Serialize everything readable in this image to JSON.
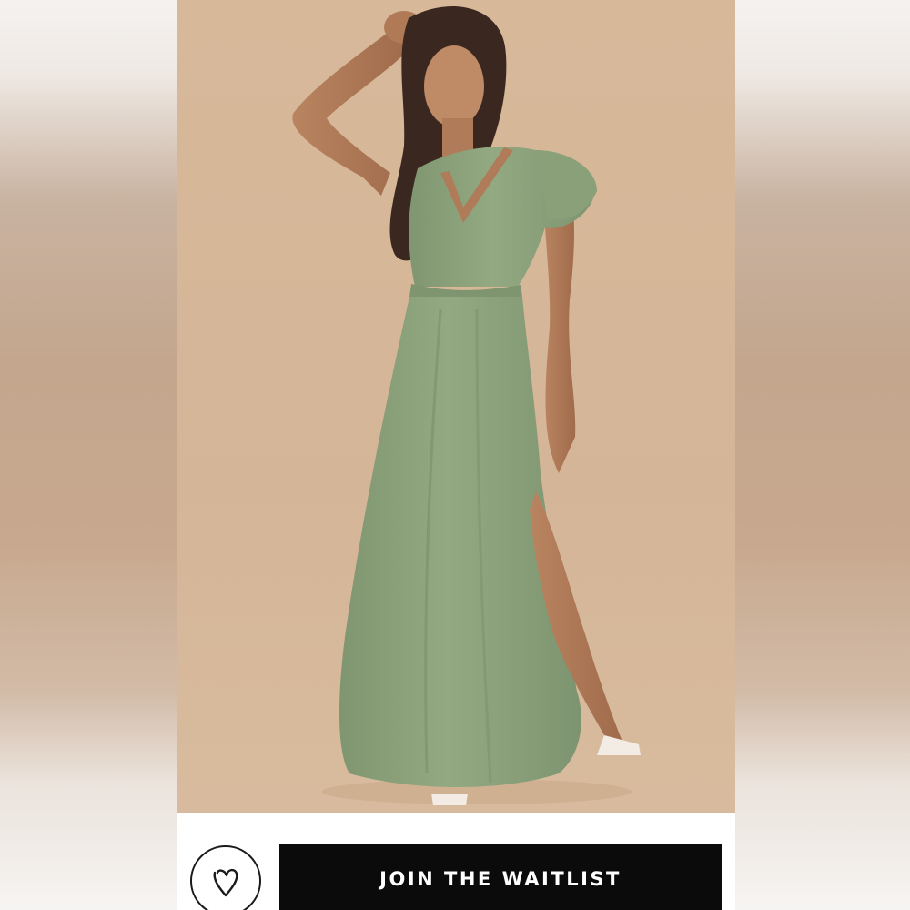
{
  "listing": {
    "photo": {
      "subject": "model-in-green-maxi-dress"
    },
    "actions": {
      "like_icon": "heart-icon",
      "waitlist_label": "JOIN THE WAITLIST"
    }
  },
  "colors": {
    "backdrop": "#d6b797",
    "dress": "#8ea47c",
    "button_bg": "#0b0b0b",
    "button_text": "#ffffff"
  }
}
